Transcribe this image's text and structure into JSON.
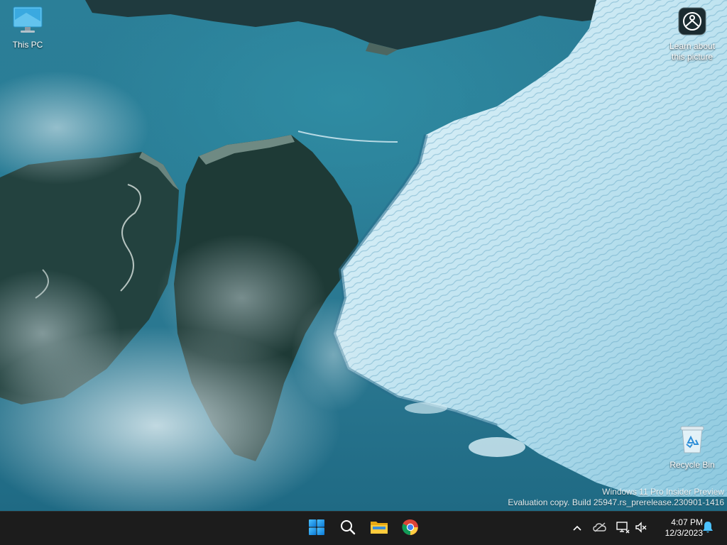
{
  "desktop": {
    "icons": [
      {
        "label": "This PC",
        "icon": "monitor-icon"
      },
      {
        "label": "Learn about\nthis picture",
        "icon": "learn-about-picture-icon"
      },
      {
        "label": "Recycle Bin",
        "icon": "recycle-bin-icon"
      }
    ],
    "watermark": {
      "line1": "Windows 11 Pro Insider Preview",
      "line2": "Evaluation copy. Build 25947.rs_prerelease.230901-1416"
    }
  },
  "taskbar": {
    "apps": [
      {
        "name": "Start",
        "icon": "windows-logo-icon"
      },
      {
        "name": "Search",
        "icon": "search-icon"
      },
      {
        "name": "File Explorer",
        "icon": "folder-icon"
      },
      {
        "name": "Google Chrome",
        "icon": "chrome-icon"
      }
    ],
    "tray": {
      "icons": [
        "chevron-up-icon",
        "onedrive-icon",
        "network-icon",
        "volume-muted-icon",
        "bell-icon"
      ],
      "time": "4:07 PM",
      "date": "12/3/2023"
    },
    "colors": {
      "background": "#1c1c1c",
      "accent": "#0078d4"
    }
  }
}
